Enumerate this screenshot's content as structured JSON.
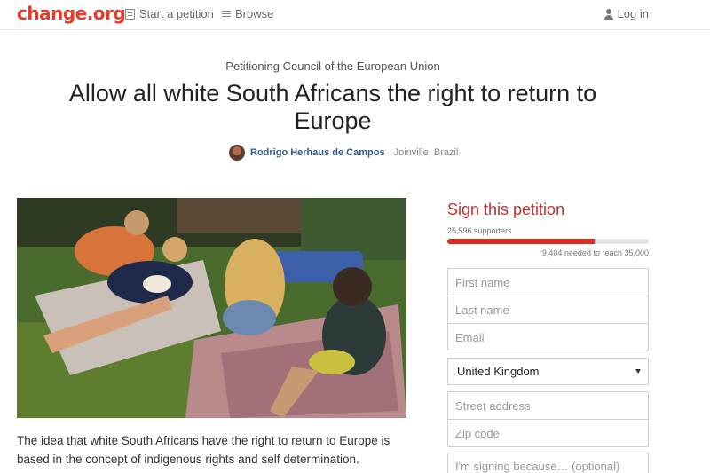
{
  "header": {
    "logo": "change.org",
    "nav": {
      "start_petition": "Start a petition",
      "browse": "Browse",
      "login": "Log in"
    }
  },
  "petition": {
    "petitioning": "Petitioning Council of the European Union",
    "title": "Allow all white South Africans the right to return to Europe",
    "author_name": "Rodrigo Herhaus de Campos",
    "author_location": "Joinville, Brazil",
    "body_text": "The idea that white South Africans have the right to return to Europe is based in the concept of indigenous rights and self determination."
  },
  "sign": {
    "title": "Sign this petition",
    "supporters": "25,596 supporters",
    "progress_fraction": 0.7313,
    "needed": "9,404 needed to reach 35,000",
    "fields": {
      "first_name": "First name",
      "last_name": "Last name",
      "email": "Email",
      "country": "United Kingdom",
      "street": "Street address",
      "zip": "Zip code",
      "reason": "I'm signing because… (optional)"
    }
  },
  "colors": {
    "brand": "#e8392b",
    "link": "#2f5d8a",
    "progress": "#d62d20"
  }
}
